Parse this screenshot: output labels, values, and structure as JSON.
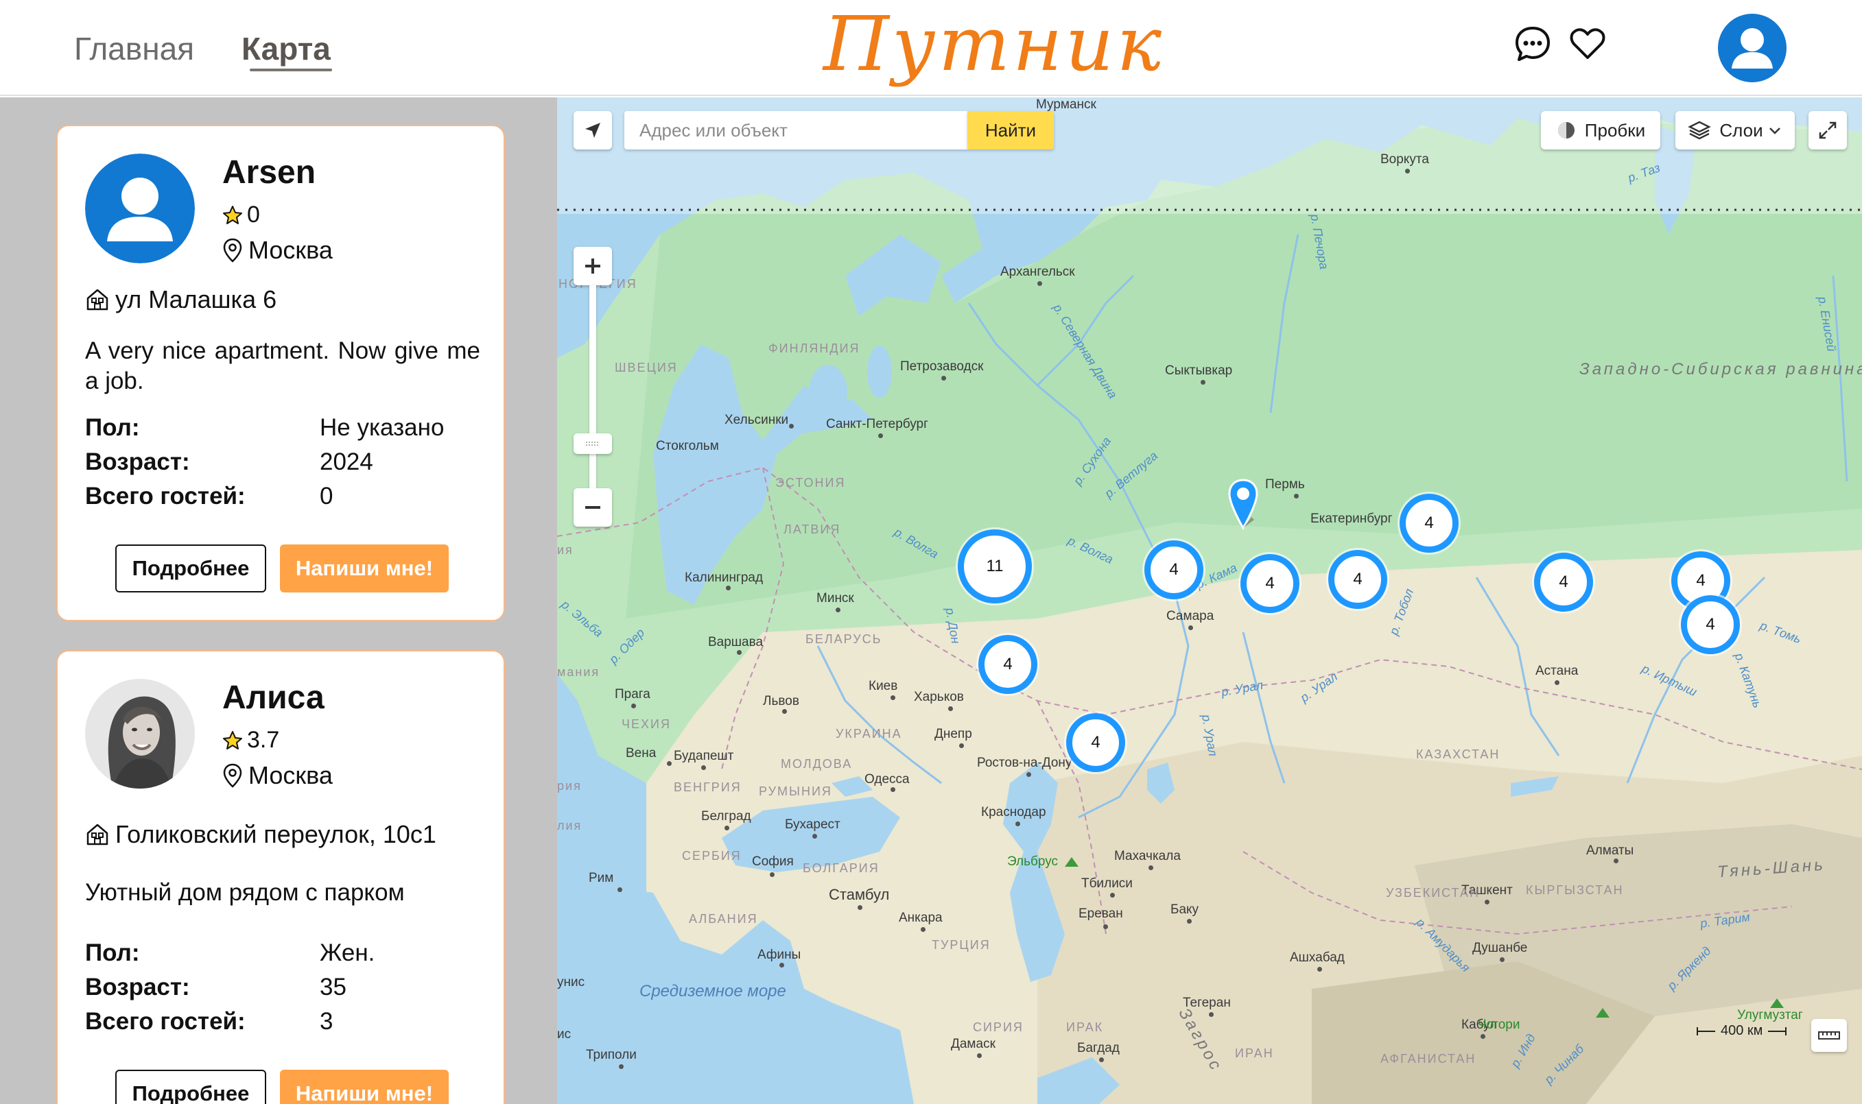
{
  "header": {
    "nav": [
      {
        "label": "Главная"
      },
      {
        "label": "Карта"
      }
    ],
    "logo": "Путник",
    "icons": [
      "chat-icon",
      "heart-icon",
      "user-avatar-icon"
    ]
  },
  "cards": [
    {
      "name": "Arsen",
      "rating": "0",
      "city": "Москва",
      "address": "ул Малашка 6",
      "description": "A very nice apartment. Now give me a job.",
      "fields": [
        {
          "label": "Пол:",
          "value": "Не указано"
        },
        {
          "label": "Возраст:",
          "value": "2024"
        },
        {
          "label": "Всего гостей:",
          "value": "0"
        }
      ],
      "more_label": "Подробнее",
      "write_label": "Напиши мне!"
    },
    {
      "name": "Алиса",
      "rating": "3.7",
      "city": "Москва",
      "address": "Голиковский переулок, 10с1",
      "description": "Уютный дом рядом с парком",
      "fields": [
        {
          "label": "Пол:",
          "value": "Жен."
        },
        {
          "label": "Возраст:",
          "value": "35"
        },
        {
          "label": "Всего гостей:",
          "value": "3"
        }
      ],
      "more_label": "Подробнее",
      "write_label": "Напиши мне!"
    }
  ],
  "map": {
    "search_placeholder": "Адрес или объект",
    "search_button": "Найти",
    "traffic_label": "Пробки",
    "layers_label": "Слои",
    "scale_label": "400 км",
    "clusters": [
      "11",
      "4",
      "4",
      "4",
      "4",
      "4",
      "4",
      "4",
      "4",
      "4"
    ],
    "colors": {
      "cluster": "#1e98ff",
      "search_button": "#ffdb4d",
      "accent": "#ffa346",
      "logo": "#f07d18"
    },
    "cities": [
      "Воркута",
      "Архангельск",
      "Петрозаводск",
      "Сыктывкар",
      "Хельсинки",
      "Санкт-Петербург",
      "Стокгольм",
      "Пермь",
      "Екатеринбург",
      "Калининград",
      "Минск",
      "Самара",
      "Варшава",
      "Прага",
      "Львов",
      "Киев",
      "Харьков",
      "Днепр",
      "Вена",
      "Будапешт",
      "Ростов-на-Дону",
      "Одесса",
      "Краснодар",
      "Белград",
      "Бухарест",
      "Махачкала",
      "София",
      "Тбилиси",
      "Рим",
      "Стамбул",
      "Анкара",
      "Ереван",
      "Баку",
      "Афины",
      "Ашхабад",
      "Тегеран",
      "Дамаск",
      "Багдад",
      "Триполи",
      "Астана",
      "Алматы",
      "Ташкент",
      "Душанбе",
      "Кабул",
      "Эльбрус",
      "Чогори",
      "Улугмузтаг"
    ],
    "countries": [
      "НОРВЕГИЯ",
      "ФИНЛЯНДИЯ",
      "ШВЕЦИЯ",
      "ЭСТОНИЯ",
      "ЛАТВИЯ",
      "БЕЛАРУСЬ",
      "УКРАИНА",
      "ЧЕХИЯ",
      "МОЛДОВА",
      "РУМЫНИЯ",
      "ВЕНГРИЯ",
      "СЕРБИЯ",
      "БОЛГАРИЯ",
      "АЛБАНИЯ",
      "ТУРЦИЯ",
      "СИРИЯ",
      "ИРАК",
      "ИРАН",
      "КАЗАХСТАН",
      "УЗБЕКИСТАН",
      "КЫРГЫЗСТАН",
      "АФГАНИСТАН"
    ],
    "rivers": [
      "р. Печора",
      "р. Северная Двина",
      "р. Сухона",
      "р. Ветлуга",
      "р. Волга",
      "р. Волга",
      "р. Дон",
      "р. Кама",
      "р. Урал",
      "р. Урал",
      "р. Урал",
      "р. Тобол",
      "р. Иртыш",
      "р. Енисей",
      "р. Таз",
      "р. Томь",
      "р. Катунь",
      "р. Амударья",
      "р. Тарим",
      "р. Яркенд",
      "р. Инд",
      "р. Чинаб",
      "р. Эльба",
      "р. Одер"
    ],
    "seas": [
      "Средиземное море"
    ],
    "regions": [
      "Западно-Сибирская равнина",
      "Тянь-Шань",
      "Загрос"
    ],
    "partial_labels": [
      "ия",
      "мания",
      "лия",
      "рия",
      "унис",
      "ис",
      "Мурманск"
    ]
  }
}
